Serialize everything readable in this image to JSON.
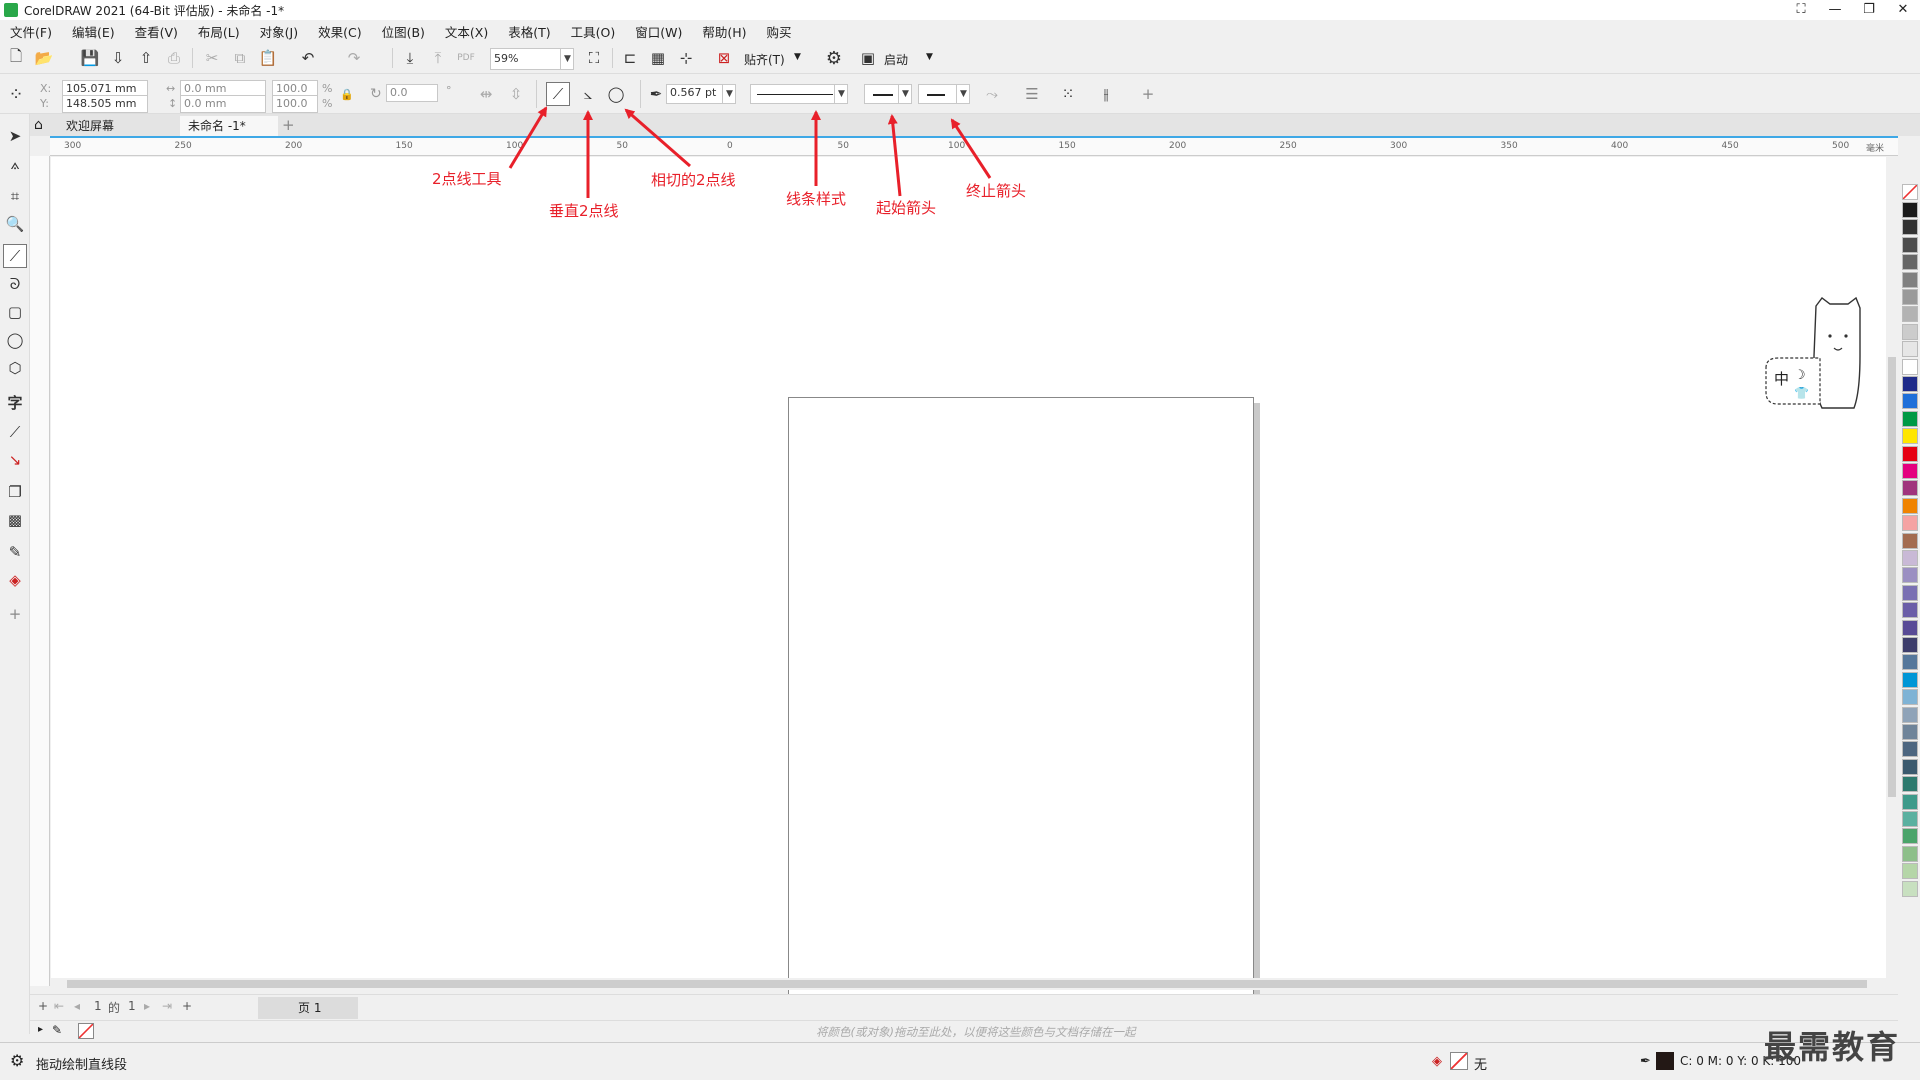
{
  "titlebar": {
    "title": "CorelDRAW 2021 (64-Bit 评估版) - 未命名 -1*"
  },
  "menu": [
    "文件(F)",
    "编辑(E)",
    "查看(V)",
    "布局(L)",
    "对象(J)",
    "效果(C)",
    "位图(B)",
    "文本(X)",
    "表格(T)",
    "工具(O)",
    "窗口(W)",
    "帮助(H)",
    "购买"
  ],
  "stdbar": {
    "zoom": "59%",
    "snap_label": "贴齐(T)",
    "launch_label": "启动"
  },
  "propbar": {
    "x_label": "X:",
    "x": "105.071 mm",
    "y_label": "Y:",
    "y": "148.505 mm",
    "w": "0.0 mm",
    "h": "0.0 mm",
    "sx": "100.0",
    "sy": "100.0",
    "angle": "0.0",
    "outline_width": "0.567 pt"
  },
  "tabs": {
    "welcome": "欢迎屏幕",
    "doc": "未命名 -1*"
  },
  "ruler": {
    "h_ticks": [
      "300",
      "250",
      "200",
      "150",
      "100",
      "50",
      "0",
      "50",
      "100",
      "150",
      "200",
      "250",
      "300",
      "350",
      "400",
      "450",
      "500"
    ],
    "h_unit": "毫米"
  },
  "annotations": {
    "two_point": "2点线工具",
    "perpendicular": "垂直2点线",
    "tangent": "相切的2点线",
    "line_style": "线条样式",
    "start_arrow": "起始箭头",
    "end_arrow": "终止箭头"
  },
  "pagenav": {
    "current": "1",
    "of": "的",
    "total": "1",
    "page_tab": "页 1"
  },
  "docpalette_hint": "将颜色(或对象)拖动至此处，以便将这些颜色与文档存储在一起",
  "statusbar": {
    "message": "拖动绘制直线段",
    "fill_label": "无",
    "cmyk": "C: 0 M: 0 Y: 0 K: 100"
  },
  "ime": {
    "text": "中"
  },
  "watermark": "最需教育",
  "palette_colors": [
    "#1a1a1a",
    "#333333",
    "#4d4d4d",
    "#666666",
    "#808080",
    "#999999",
    "#b3b3b3",
    "#cccccc",
    "#e6e6e6",
    "#ffffff",
    "#1e2a8a",
    "#1e6fd9",
    "#009944",
    "#ffe600",
    "#e60012",
    "#e4007f",
    "#a0347d",
    "#f08300",
    "#f5a3a3",
    "#a36b4f",
    "#c9b9d6",
    "#9b8fc2",
    "#7a6fb3",
    "#6b5ea8",
    "#584a96",
    "#3d3d6b",
    "#55779b",
    "#0096d6",
    "#7fb3d5",
    "#8fa3b8",
    "#6f8499",
    "#4d6680",
    "#3b5a6e",
    "#2d7a6e",
    "#3d9a8a",
    "#5ab0a0",
    "#4aa46a",
    "#8dbf8a",
    "#b5d6a8",
    "#c8e0c0"
  ]
}
